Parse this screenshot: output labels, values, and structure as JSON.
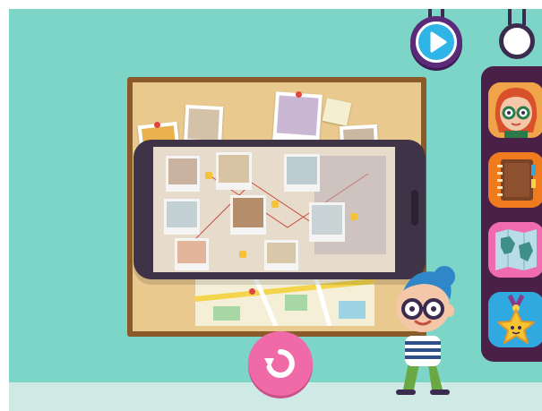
{
  "game": {
    "screen": "evidence-board"
  },
  "top_controls": {
    "play_icon": "play-icon",
    "menu_icon": "circle-icon"
  },
  "side_menu": {
    "items": [
      {
        "icon": "character-avatar-icon",
        "color": "#f1a34a"
      },
      {
        "icon": "notebook-icon",
        "color": "#f07a1e"
      },
      {
        "icon": "world-map-icon",
        "color": "#f06bb0"
      },
      {
        "icon": "star-medal-icon",
        "color": "#2fa9e0"
      }
    ]
  },
  "replay": {
    "icon": "replay-icon",
    "color": "#ef6aa6"
  },
  "colors": {
    "background": "#7dd5c8",
    "panel": "#4a2048",
    "board_frame": "#8a5a2b",
    "cork": "#e9c98d"
  }
}
